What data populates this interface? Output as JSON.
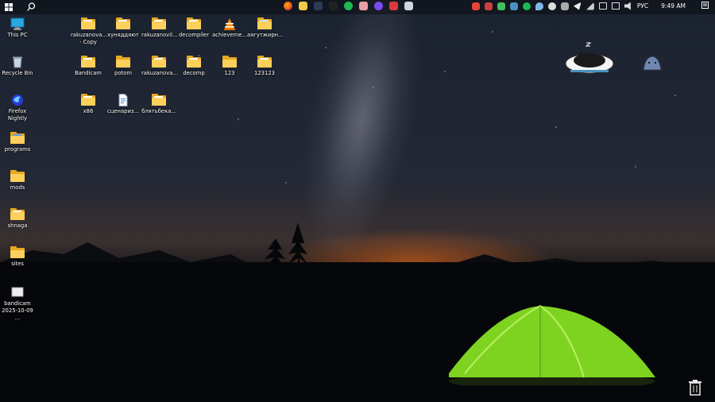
{
  "taskbar": {
    "language": "РУС",
    "time": "9:49 AM",
    "center_apps": [
      "firefox-icon",
      "file-explorer-icon",
      "vpn-icon",
      "app-dark-icon",
      "spotify-icon",
      "pink-app-icon",
      "discord-icon",
      "security-icon",
      "chat-icon"
    ],
    "tray_icons": [
      "tray-red-icon",
      "tray-red-alt-icon",
      "tray-green-icon",
      "tray-display-icon",
      "tray-spotify-icon",
      "tray-drop-icon",
      "tray-cloud-icon",
      "tray-bird-icon",
      "tray-send-icon",
      "tray-signal-icon",
      "tray-monitor-icon",
      "tray-wifi-icon",
      "tray-volume-icon"
    ]
  },
  "desktop": {
    "left_column": [
      {
        "label": "This PC",
        "icon": "monitor-icon"
      },
      {
        "label": "Recycle Bin",
        "icon": "recycle-bin-icon"
      },
      {
        "label": "Firefox\nNightly",
        "icon": "firefox-nightly-icon"
      },
      {
        "label": "programs",
        "icon": "folder-icon"
      },
      {
        "label": "mods",
        "icon": "folder-icon"
      },
      {
        "label": "shnaga",
        "icon": "folder-icon"
      },
      {
        "label": "sites",
        "icon": "folder-icon"
      },
      {
        "label": "bandicam\n2025-10-09 ...",
        "icon": "video-file-icon"
      }
    ],
    "grid_row1": [
      {
        "label": "rakuzanova...\n- Copy",
        "icon": "folder-icon"
      },
      {
        "label": "хуняддяют",
        "icon": "folder-icon"
      },
      {
        "label": "rakuzanovil...",
        "icon": "folder-icon"
      },
      {
        "label": "decompiler",
        "icon": "folder-icon"
      },
      {
        "label": "achieveme...",
        "icon": "vlc-icon"
      },
      {
        "label": "аягутжирн...",
        "icon": "folder-icon"
      }
    ],
    "grid_row2": [
      {
        "label": "Bandicam",
        "icon": "folder-icon"
      },
      {
        "label": "potom",
        "icon": "folder-icon"
      },
      {
        "label": "rakuzanova...",
        "icon": "folder-icon"
      },
      {
        "label": "decomp",
        "icon": "folder-icon"
      },
      {
        "label": "123",
        "icon": "folder-icon"
      },
      {
        "label": "123123",
        "icon": "folder-icon"
      }
    ],
    "grid_row3": [
      {
        "label": "x86",
        "icon": "folder-icon"
      },
      {
        "label": "сценариз...",
        "icon": "document-icon"
      },
      {
        "label": "блятьбека...",
        "icon": "folder-icon"
      }
    ]
  },
  "colors": {
    "folder": "#fcd05b",
    "folder_dark": "#e8a820",
    "tent": "#7ed321",
    "glow": "#ff6a14"
  }
}
